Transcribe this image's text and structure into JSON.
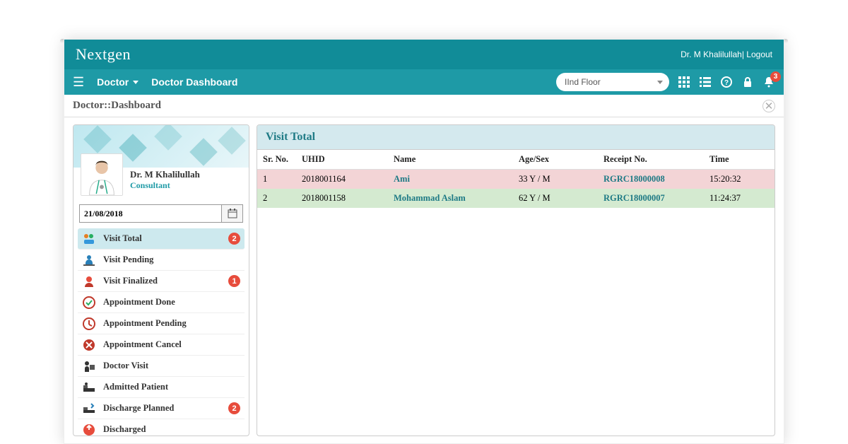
{
  "brand": "Nextgen",
  "user": {
    "name": "Dr. M Khalilullah",
    "logout": "Logout"
  },
  "nav": {
    "doctor": "Doctor",
    "dashboard": "Doctor Dashboard"
  },
  "floor_select": {
    "value": "IInd Floor"
  },
  "bell_badge": "3",
  "crumb": "Doctor::Dashboard",
  "profile": {
    "name": "Dr. M Khalilullah",
    "role": "Consultant"
  },
  "date": "21/08/2018",
  "sidebar_items": [
    {
      "label": "Visit Total",
      "count": "2",
      "active": true
    },
    {
      "label": "Visit Pending",
      "count": null
    },
    {
      "label": "Visit Finalized",
      "count": "1"
    },
    {
      "label": "Appointment Done",
      "count": null
    },
    {
      "label": "Appointment Pending",
      "count": null
    },
    {
      "label": "Appointment Cancel",
      "count": null
    },
    {
      "label": "Doctor Visit",
      "count": null
    },
    {
      "label": "Admitted Patient",
      "count": null
    },
    {
      "label": "Discharge Planned",
      "count": "2"
    },
    {
      "label": "Discharged",
      "count": null
    }
  ],
  "main_title": "Visit Total",
  "columns": {
    "sr": "Sr. No.",
    "uhid": "UHID",
    "name": "Name",
    "age": "Age/Sex",
    "receipt": "Receipt No.",
    "time": "Time"
  },
  "rows": [
    {
      "sr": "1",
      "uhid": "2018001164",
      "name": "Ami",
      "age": "33 Y / M",
      "receipt": "RGRC18000008",
      "time": "15:20:32",
      "cls": "row-pink"
    },
    {
      "sr": "2",
      "uhid": "2018001158",
      "name": "Mohammad Aslam",
      "age": "62 Y / M",
      "receipt": "RGRC18000007",
      "time": "11:24:37",
      "cls": "row-green"
    }
  ]
}
